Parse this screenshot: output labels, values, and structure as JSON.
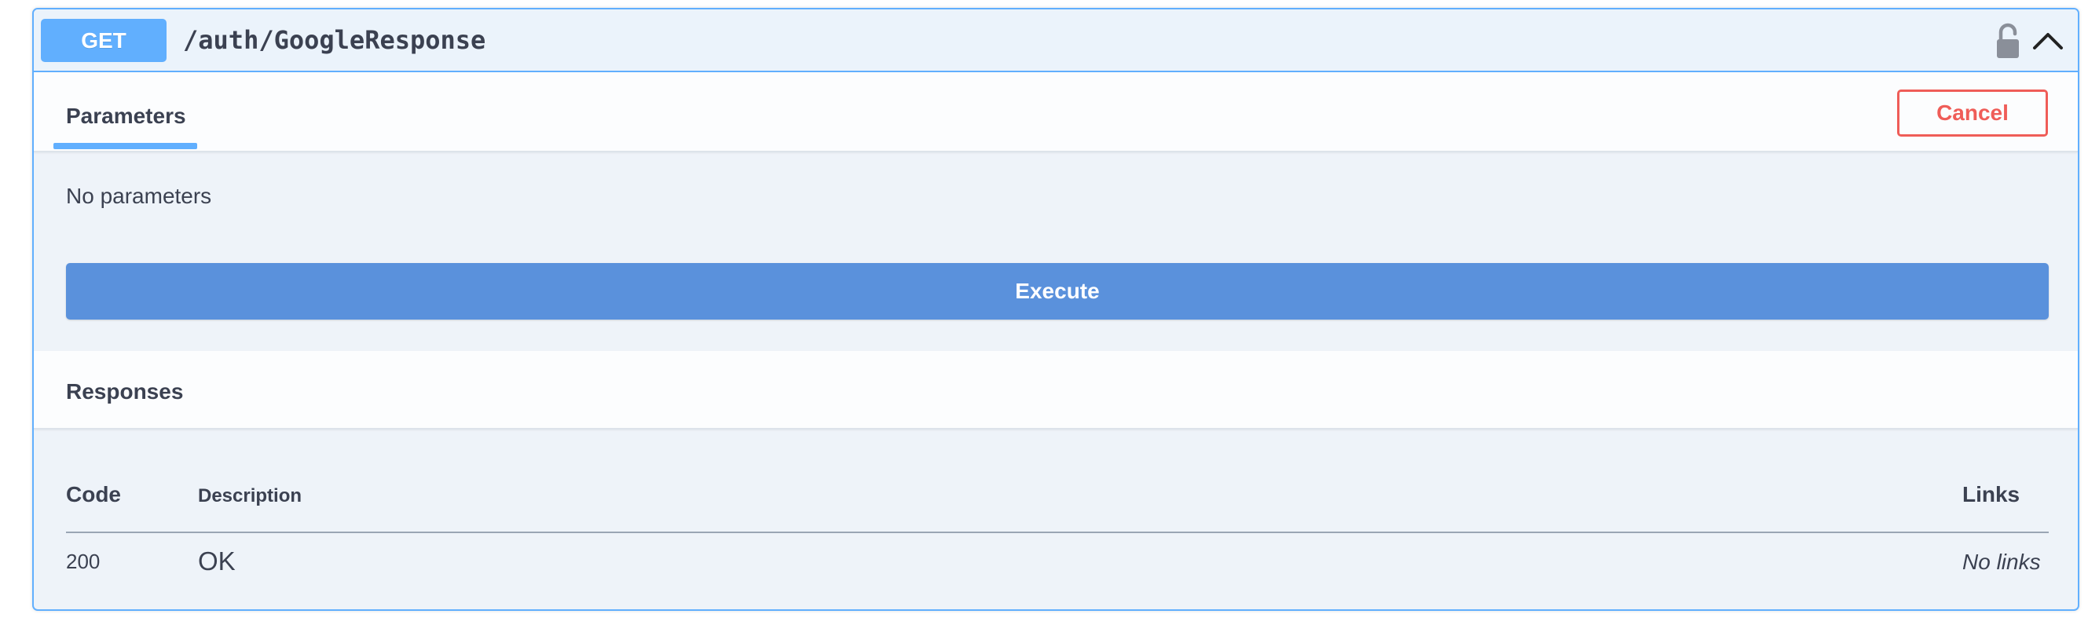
{
  "operation": {
    "method": "GET",
    "path": "/auth/GoogleResponse",
    "icons": {
      "lock": "unlocked-padlock-icon",
      "collapse": "chevron-up-icon"
    }
  },
  "tabs": {
    "parameters_label": "Parameters",
    "cancel_label": "Cancel"
  },
  "parameters": {
    "empty_text": "No parameters"
  },
  "execute": {
    "label": "Execute"
  },
  "responses": {
    "title": "Responses",
    "columns": {
      "code": "Code",
      "description": "Description",
      "links": "Links"
    },
    "rows": [
      {
        "code": "200",
        "description": "OK",
        "links": "No links"
      }
    ]
  },
  "colors": {
    "get_method": "#61affe",
    "execute_button": "#5a91dc",
    "cancel_button": "#ef5d58",
    "panel_background": "#eef3f9"
  }
}
